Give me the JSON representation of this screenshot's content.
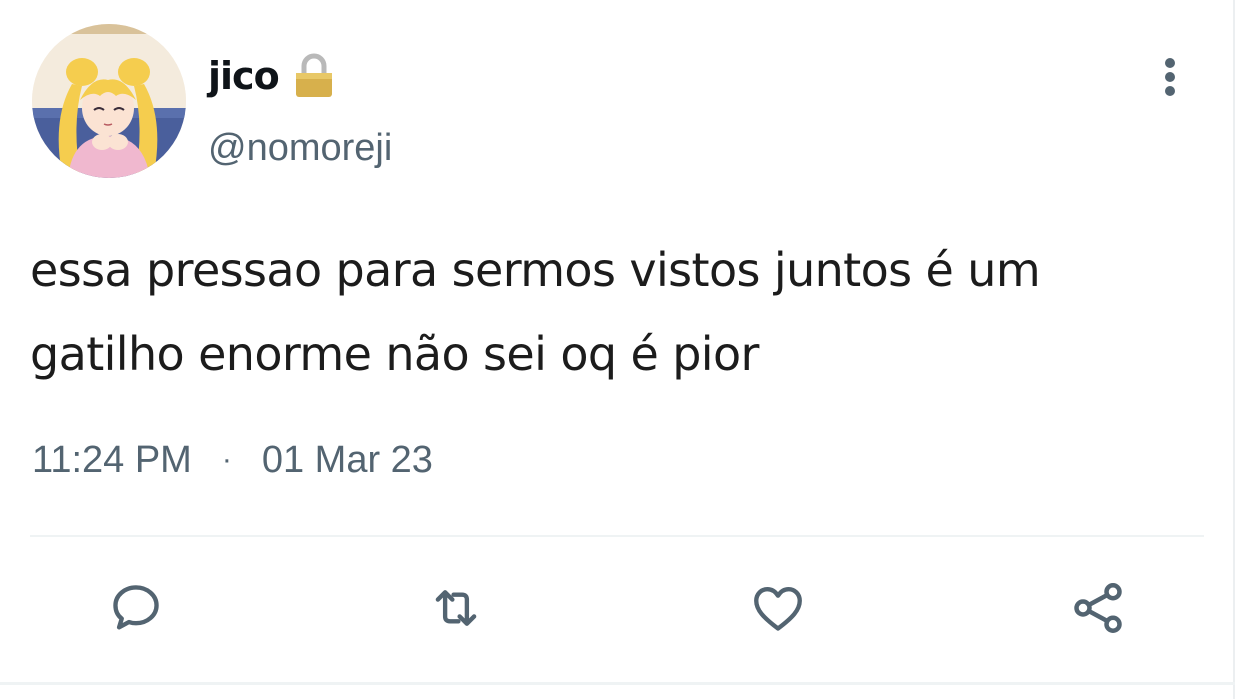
{
  "author": {
    "display_name": "jico",
    "handle": "@nomoreji",
    "avatar_icon": "avatar-anime-girl",
    "protected_icon": "lock-icon"
  },
  "tweet": {
    "text": "essa pressao para sermos vistos juntos é um gatilho enorme não sei oq é pior",
    "time": "11:24 PM",
    "separator": "·",
    "date": "01 Mar 23"
  },
  "actions": {
    "reply_icon": "reply-icon",
    "retweet_icon": "retweet-icon",
    "like_icon": "heart-icon",
    "share_icon": "share-icon",
    "more_icon": "more-vertical-icon"
  },
  "colors": {
    "text": "#0f1419",
    "secondary": "#536471",
    "divider": "#eff3f4"
  }
}
